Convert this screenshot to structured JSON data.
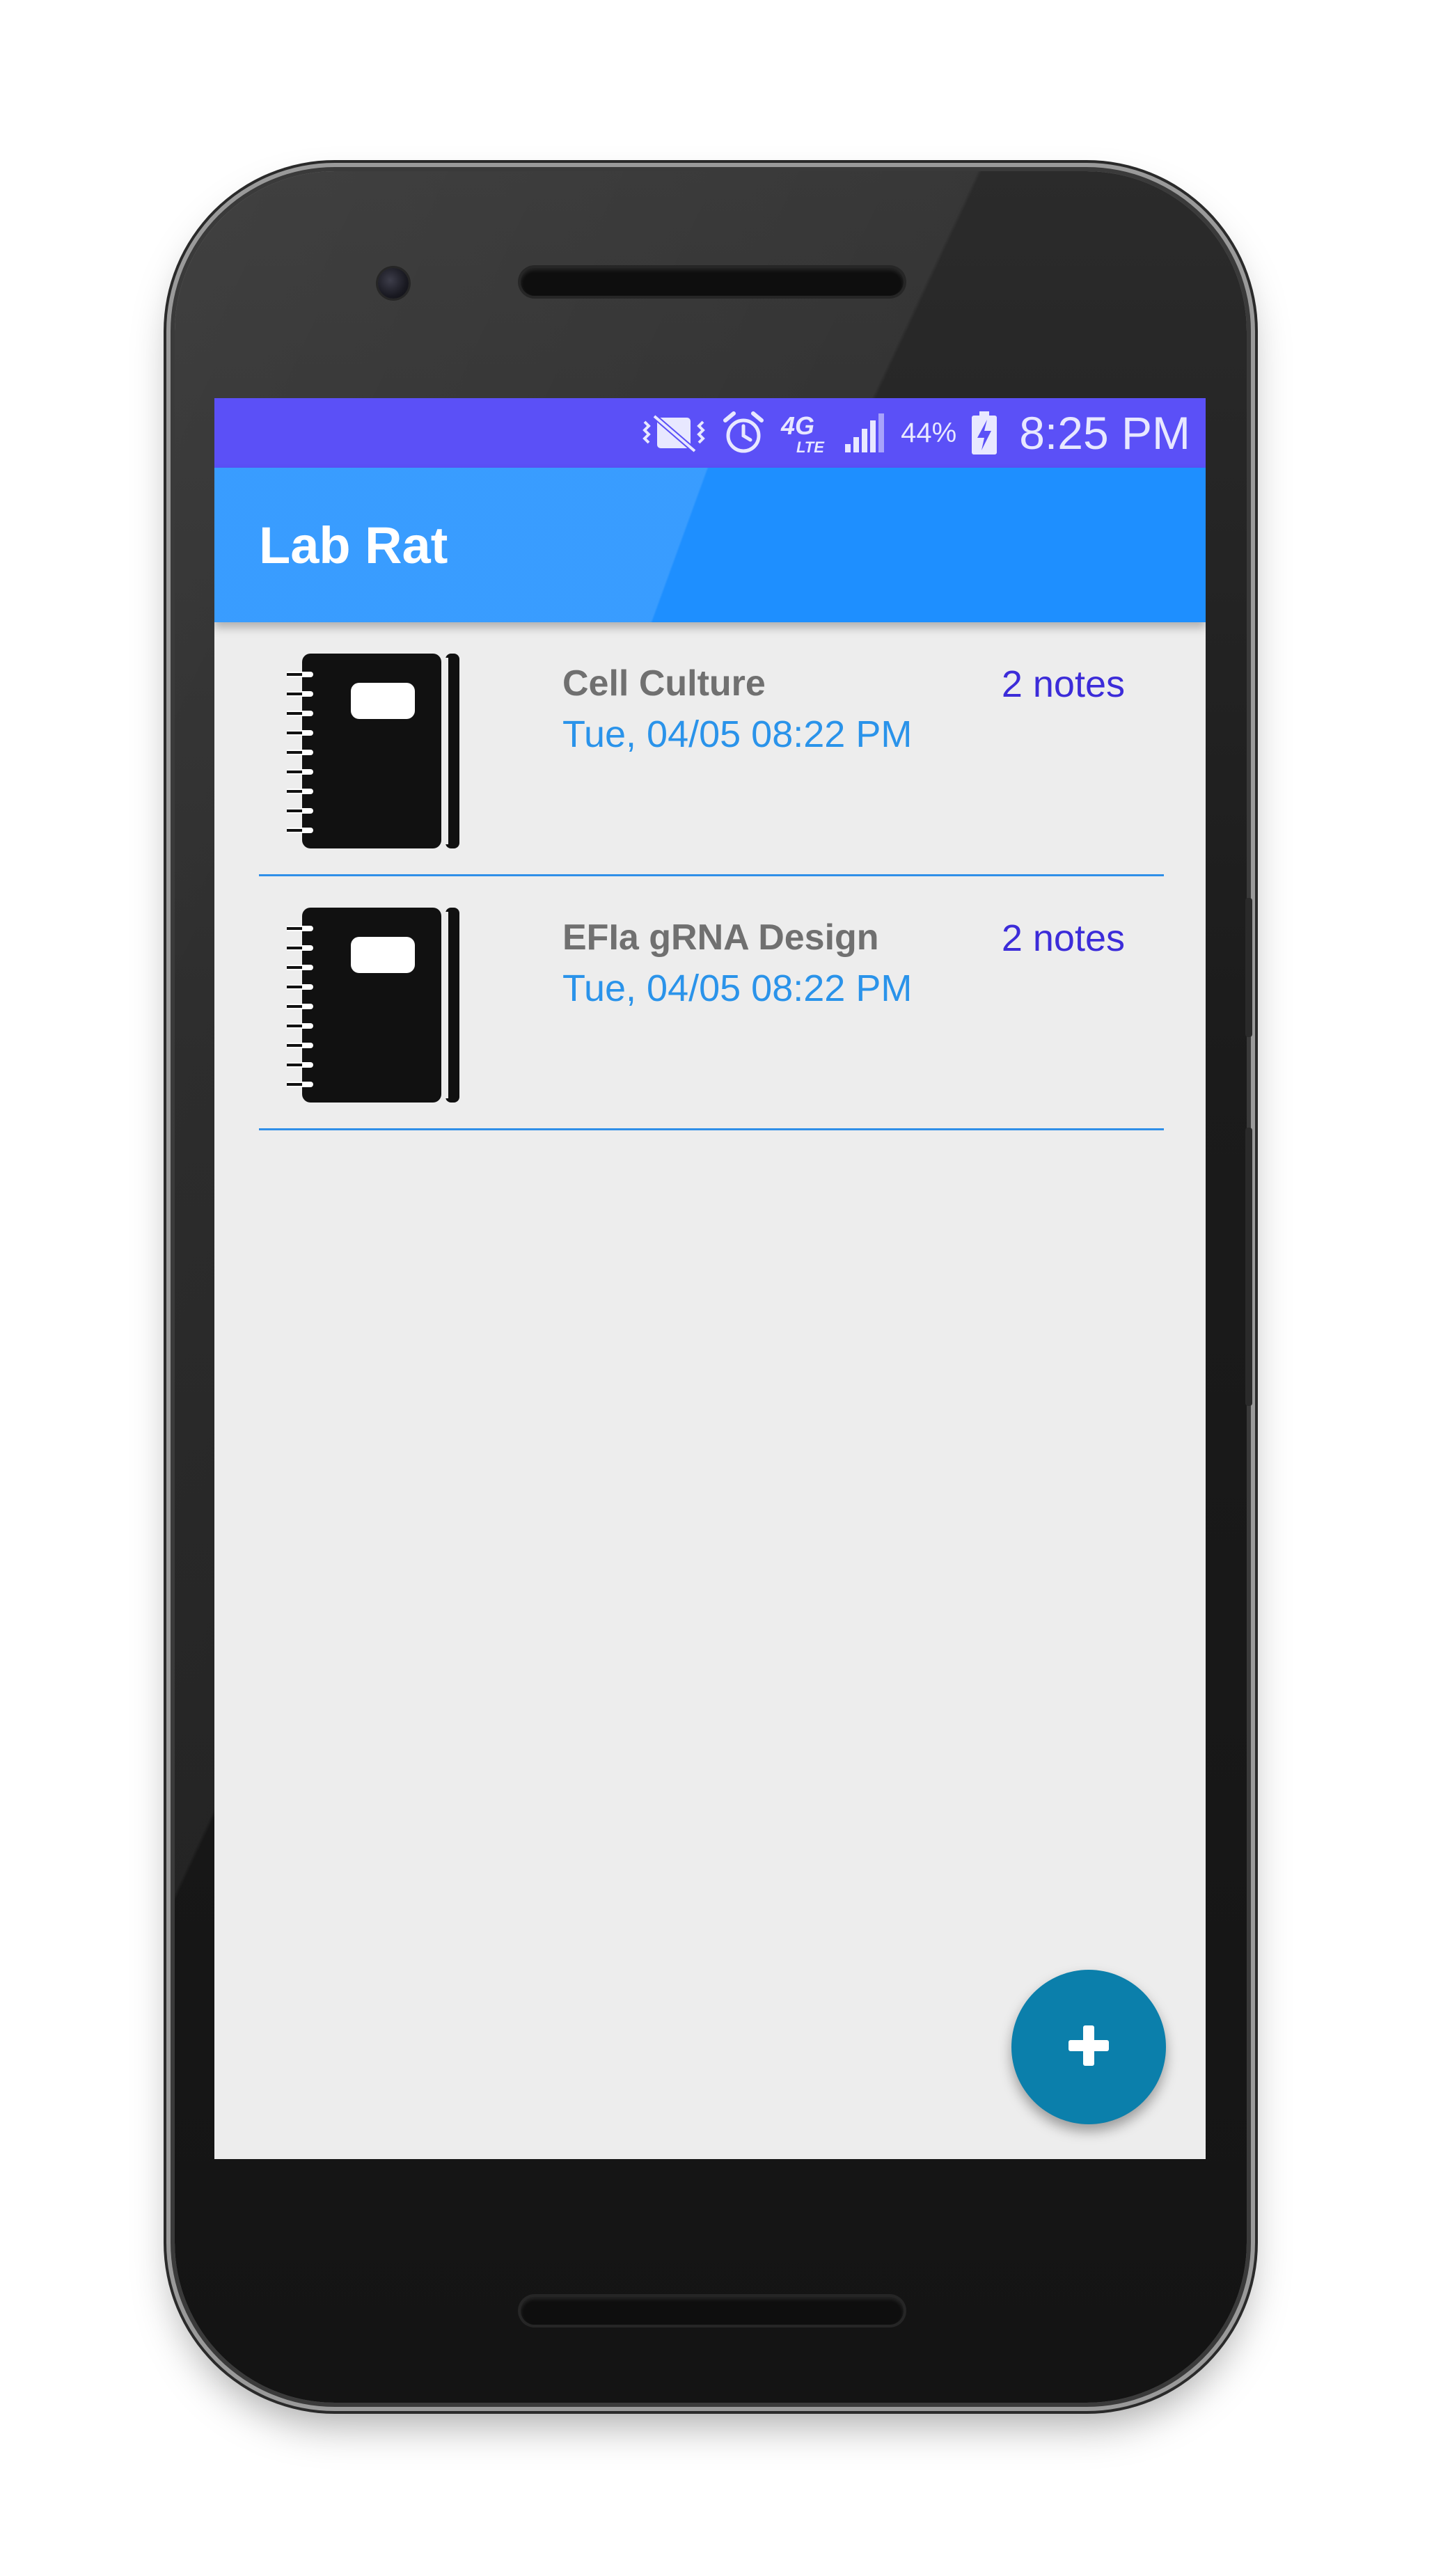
{
  "status_bar": {
    "battery_percent": "44%",
    "time": "8:25 PM",
    "network": "4G LTE",
    "icons": [
      "vibrate-icon",
      "alarm-icon",
      "4g-lte-icon",
      "signal-icon",
      "battery-charging-icon"
    ]
  },
  "app_bar": {
    "title": "Lab Rat"
  },
  "notebooks": [
    {
      "title": "Cell Culture",
      "date": "Tue, 04/05 08:22 PM",
      "count": "2 notes",
      "icon": "notebook-icon"
    },
    {
      "title": "EFIa gRNA Design",
      "date": "Tue, 04/05 08:22 PM",
      "count": "2 notes",
      "icon": "notebook-icon"
    }
  ],
  "fab": {
    "icon": "plus-icon"
  },
  "colors": {
    "status_bar": "#5b50f7",
    "app_bar": "#1e8fff",
    "date_text": "#2a93ea",
    "count_text": "#3c2cd9",
    "fab": "#0b7fab",
    "divider": "#2f8fe8"
  }
}
